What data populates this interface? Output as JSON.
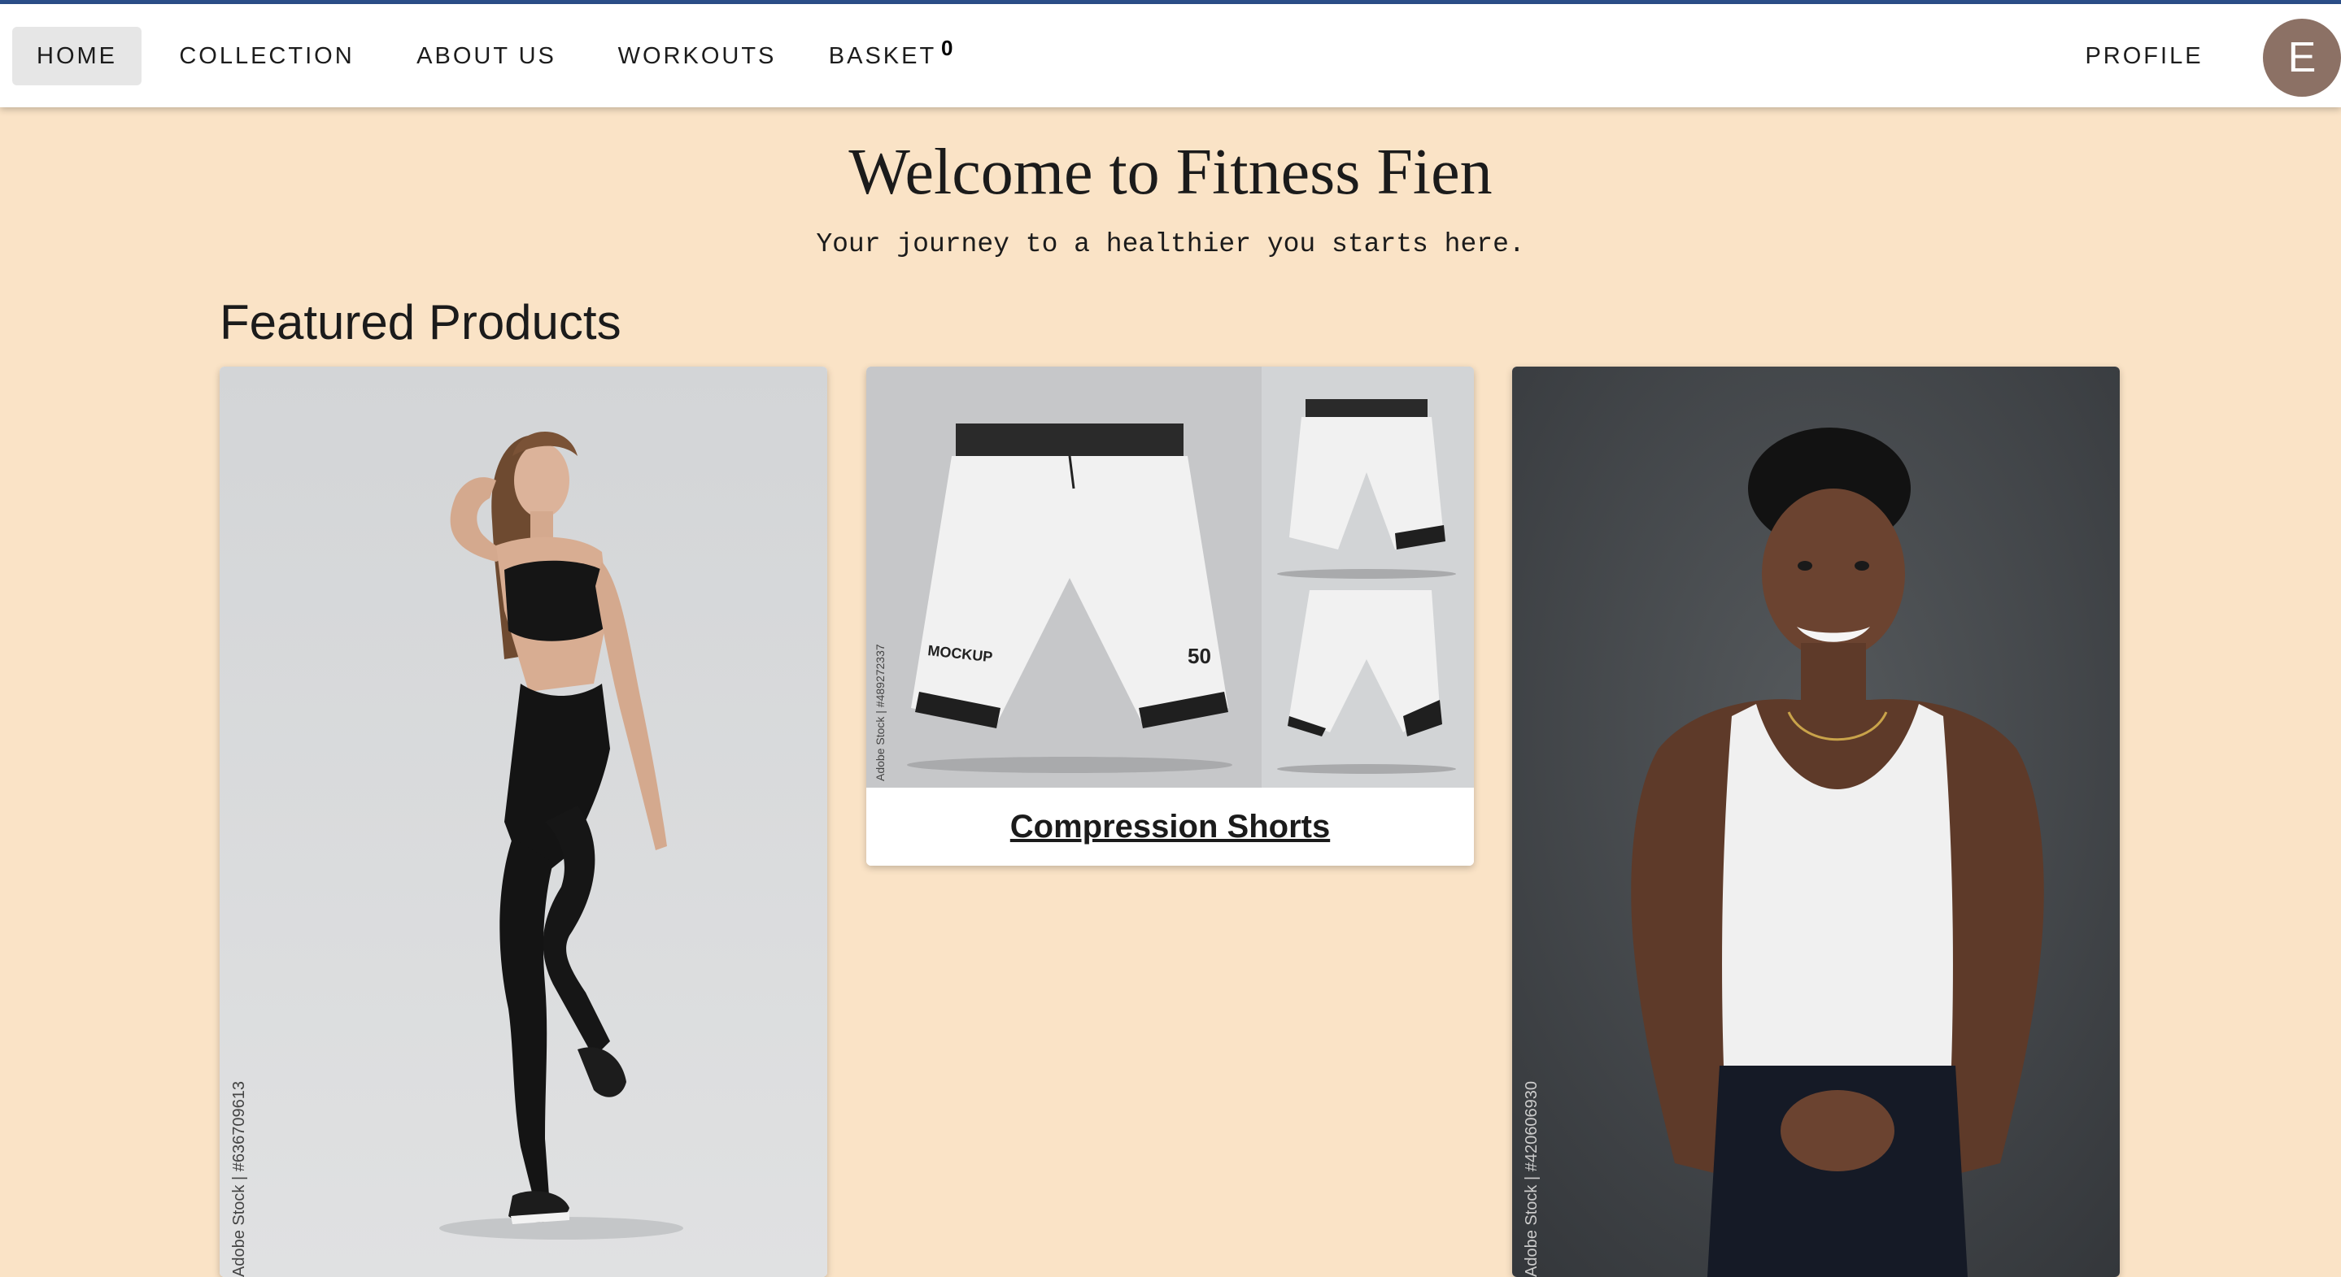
{
  "nav": {
    "items": [
      {
        "label": "HOME",
        "active": true
      },
      {
        "label": "COLLECTION"
      },
      {
        "label": "ABOUT US"
      },
      {
        "label": "WORKOUTS"
      },
      {
        "label": "BASKET"
      }
    ],
    "basket_count": "0",
    "profile_label": "PROFILE",
    "avatar_letter": "E",
    "accent_color": "#2c4f8a"
  },
  "hero": {
    "title": "Welcome to Fitness Fien",
    "subtitle": "Your journey to a healthier you starts here."
  },
  "featured": {
    "heading": "Featured Products",
    "products": [
      {
        "label": "",
        "image": "woman-in-black-activewear-photo",
        "watermark": "Adobe Stock | #636709613"
      },
      {
        "label": "Compression Shorts",
        "image": "white-compression-shorts-mockup-photo",
        "watermark": "Adobe Stock | #489272337"
      },
      {
        "label": "",
        "image": "man-in-white-tank-top-photo",
        "watermark": "Adobe Stock | #420606930"
      }
    ]
  }
}
